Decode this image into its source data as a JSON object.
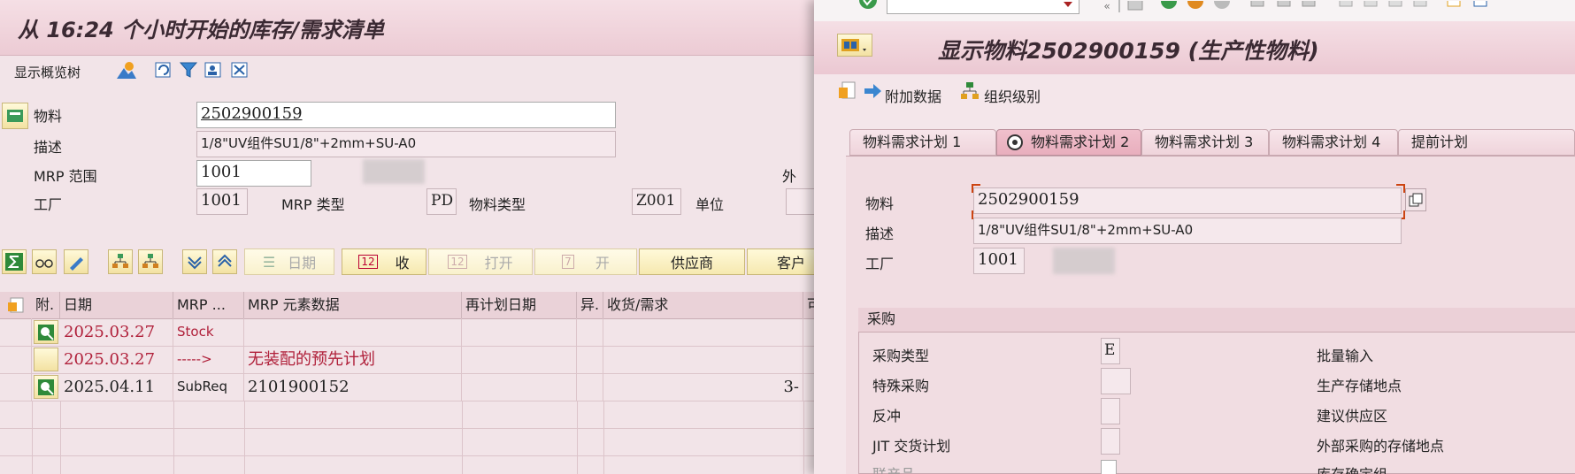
{
  "left": {
    "title": "从 16:24 个小时开始的库存/需求清单",
    "toolbar": {
      "tree_label": "显示概览树"
    },
    "header": {
      "material_label": "物料",
      "material_value": "2502900159",
      "desc_label": "描述",
      "desc_value": "1/8\"UV组件SU1/8\"+2mm+SU-A0",
      "mrp_area_label": "MRP 范围",
      "mrp_area_value": "1001",
      "plant_label": "工厂",
      "plant_value": "1001",
      "mrp_type_label": "MRP 类型",
      "mrp_type_value": "PD",
      "mat_type_label": "物料类型",
      "mat_type_value": "Z001",
      "unit_label": "单位",
      "outside_label": "外"
    },
    "buttons": {
      "date": "日期",
      "receipt": "收",
      "open": "打开",
      "open2": "开",
      "vendor": "供应商",
      "customer": "客户"
    },
    "columns": [
      "附.",
      "日期",
      "MRP ...",
      "MRP 元素数据",
      "再计划日期",
      "异.",
      "收货/需求",
      "可"
    ],
    "rows": [
      {
        "date": "2025.03.27",
        "mrp": "Stock",
        "data": "",
        "qty": ""
      },
      {
        "date": "2025.03.27",
        "mrp": "----->",
        "data": "无装配的预先计划",
        "qty": ""
      },
      {
        "date": "2025.04.11",
        "mrp": "SubReq",
        "data": "2101900152",
        "qty": "3-"
      }
    ]
  },
  "right": {
    "title": "显示物料2502900159 (生产性物料)",
    "toolbar": {
      "additional_data": "附加数据",
      "org_levels": "组织级别"
    },
    "tabs": [
      "物料需求计划 1",
      "物料需求计划 2",
      "物料需求计划 3",
      "物料需求计划 4",
      "提前计划"
    ],
    "active_tab": "物料需求计划 2",
    "material_label": "物料",
    "material_value": "2502900159",
    "desc_label": "描述",
    "desc_value": "1/8\"UV组件SU1/8\"+2mm+SU-A0",
    "plant_label": "工厂",
    "plant_value": "1001",
    "section_title": "采购",
    "fields_left": [
      {
        "label": "采购类型",
        "value": "E"
      },
      {
        "label": "特殊采购",
        "value": ""
      },
      {
        "label": "反冲",
        "value": ""
      },
      {
        "label": "JIT 交货计划",
        "value": ""
      },
      {
        "label": "联产品",
        "value": ""
      }
    ],
    "fields_right": [
      "批量输入",
      "生产存储地点",
      "建议供应区",
      "外部采购的存储地点",
      "库存确定组"
    ]
  }
}
